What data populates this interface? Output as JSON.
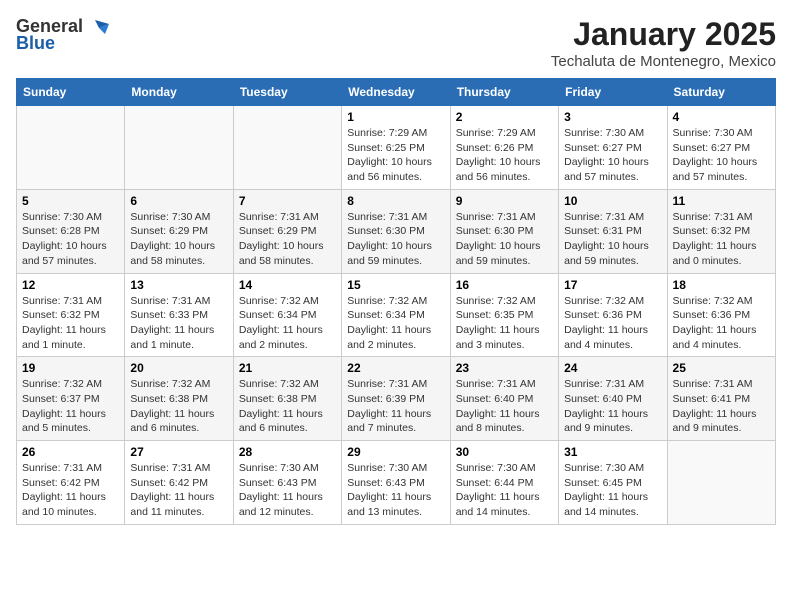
{
  "header": {
    "logo_general": "General",
    "logo_blue": "Blue",
    "month_title": "January 2025",
    "location": "Techaluta de Montenegro, Mexico"
  },
  "days_of_week": [
    "Sunday",
    "Monday",
    "Tuesday",
    "Wednesday",
    "Thursday",
    "Friday",
    "Saturday"
  ],
  "weeks": [
    [
      {
        "day": "",
        "info": ""
      },
      {
        "day": "",
        "info": ""
      },
      {
        "day": "",
        "info": ""
      },
      {
        "day": "1",
        "info": "Sunrise: 7:29 AM\nSunset: 6:25 PM\nDaylight: 10 hours\nand 56 minutes."
      },
      {
        "day": "2",
        "info": "Sunrise: 7:29 AM\nSunset: 6:26 PM\nDaylight: 10 hours\nand 56 minutes."
      },
      {
        "day": "3",
        "info": "Sunrise: 7:30 AM\nSunset: 6:27 PM\nDaylight: 10 hours\nand 57 minutes."
      },
      {
        "day": "4",
        "info": "Sunrise: 7:30 AM\nSunset: 6:27 PM\nDaylight: 10 hours\nand 57 minutes."
      }
    ],
    [
      {
        "day": "5",
        "info": "Sunrise: 7:30 AM\nSunset: 6:28 PM\nDaylight: 10 hours\nand 57 minutes."
      },
      {
        "day": "6",
        "info": "Sunrise: 7:30 AM\nSunset: 6:29 PM\nDaylight: 10 hours\nand 58 minutes."
      },
      {
        "day": "7",
        "info": "Sunrise: 7:31 AM\nSunset: 6:29 PM\nDaylight: 10 hours\nand 58 minutes."
      },
      {
        "day": "8",
        "info": "Sunrise: 7:31 AM\nSunset: 6:30 PM\nDaylight: 10 hours\nand 59 minutes."
      },
      {
        "day": "9",
        "info": "Sunrise: 7:31 AM\nSunset: 6:30 PM\nDaylight: 10 hours\nand 59 minutes."
      },
      {
        "day": "10",
        "info": "Sunrise: 7:31 AM\nSunset: 6:31 PM\nDaylight: 10 hours\nand 59 minutes."
      },
      {
        "day": "11",
        "info": "Sunrise: 7:31 AM\nSunset: 6:32 PM\nDaylight: 11 hours\nand 0 minutes."
      }
    ],
    [
      {
        "day": "12",
        "info": "Sunrise: 7:31 AM\nSunset: 6:32 PM\nDaylight: 11 hours\nand 1 minute."
      },
      {
        "day": "13",
        "info": "Sunrise: 7:31 AM\nSunset: 6:33 PM\nDaylight: 11 hours\nand 1 minute."
      },
      {
        "day": "14",
        "info": "Sunrise: 7:32 AM\nSunset: 6:34 PM\nDaylight: 11 hours\nand 2 minutes."
      },
      {
        "day": "15",
        "info": "Sunrise: 7:32 AM\nSunset: 6:34 PM\nDaylight: 11 hours\nand 2 minutes."
      },
      {
        "day": "16",
        "info": "Sunrise: 7:32 AM\nSunset: 6:35 PM\nDaylight: 11 hours\nand 3 minutes."
      },
      {
        "day": "17",
        "info": "Sunrise: 7:32 AM\nSunset: 6:36 PM\nDaylight: 11 hours\nand 4 minutes."
      },
      {
        "day": "18",
        "info": "Sunrise: 7:32 AM\nSunset: 6:36 PM\nDaylight: 11 hours\nand 4 minutes."
      }
    ],
    [
      {
        "day": "19",
        "info": "Sunrise: 7:32 AM\nSunset: 6:37 PM\nDaylight: 11 hours\nand 5 minutes."
      },
      {
        "day": "20",
        "info": "Sunrise: 7:32 AM\nSunset: 6:38 PM\nDaylight: 11 hours\nand 6 minutes."
      },
      {
        "day": "21",
        "info": "Sunrise: 7:32 AM\nSunset: 6:38 PM\nDaylight: 11 hours\nand 6 minutes."
      },
      {
        "day": "22",
        "info": "Sunrise: 7:31 AM\nSunset: 6:39 PM\nDaylight: 11 hours\nand 7 minutes."
      },
      {
        "day": "23",
        "info": "Sunrise: 7:31 AM\nSunset: 6:40 PM\nDaylight: 11 hours\nand 8 minutes."
      },
      {
        "day": "24",
        "info": "Sunrise: 7:31 AM\nSunset: 6:40 PM\nDaylight: 11 hours\nand 9 minutes."
      },
      {
        "day": "25",
        "info": "Sunrise: 7:31 AM\nSunset: 6:41 PM\nDaylight: 11 hours\nand 9 minutes."
      }
    ],
    [
      {
        "day": "26",
        "info": "Sunrise: 7:31 AM\nSunset: 6:42 PM\nDaylight: 11 hours\nand 10 minutes."
      },
      {
        "day": "27",
        "info": "Sunrise: 7:31 AM\nSunset: 6:42 PM\nDaylight: 11 hours\nand 11 minutes."
      },
      {
        "day": "28",
        "info": "Sunrise: 7:30 AM\nSunset: 6:43 PM\nDaylight: 11 hours\nand 12 minutes."
      },
      {
        "day": "29",
        "info": "Sunrise: 7:30 AM\nSunset: 6:43 PM\nDaylight: 11 hours\nand 13 minutes."
      },
      {
        "day": "30",
        "info": "Sunrise: 7:30 AM\nSunset: 6:44 PM\nDaylight: 11 hours\nand 14 minutes."
      },
      {
        "day": "31",
        "info": "Sunrise: 7:30 AM\nSunset: 6:45 PM\nDaylight: 11 hours\nand 14 minutes."
      },
      {
        "day": "",
        "info": ""
      }
    ]
  ]
}
